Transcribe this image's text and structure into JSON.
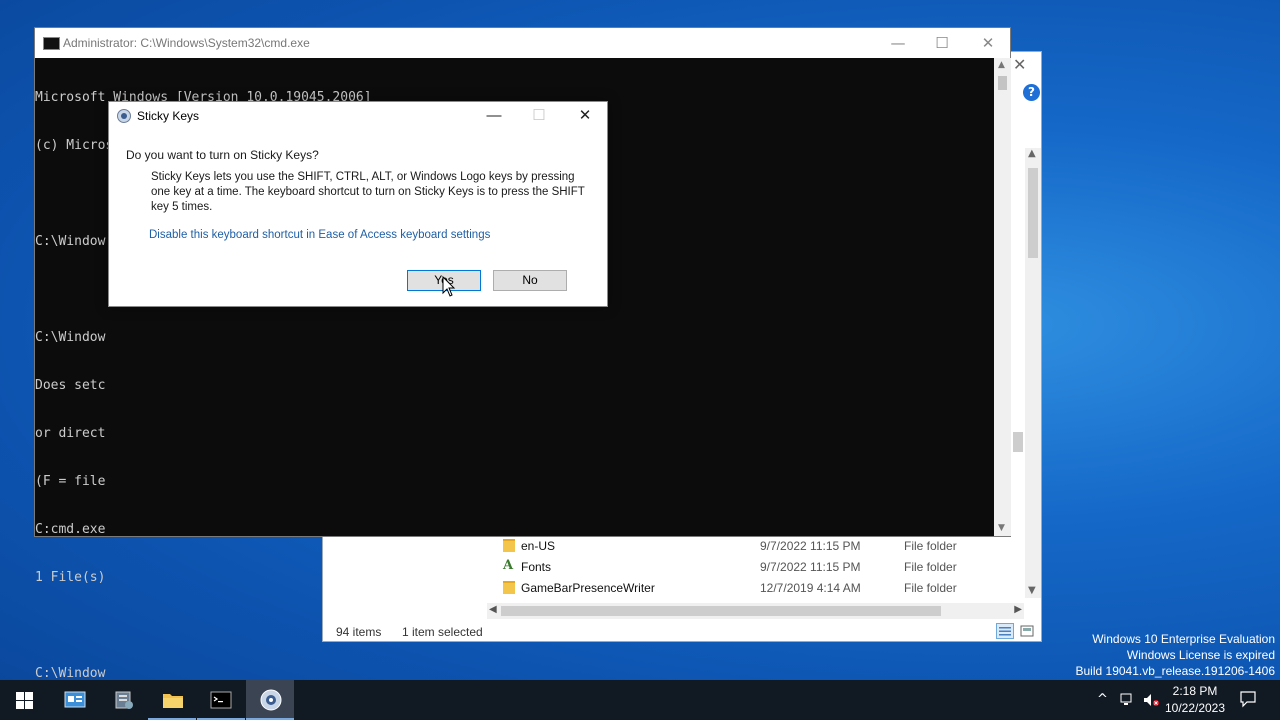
{
  "explorer": {
    "rows": [
      {
        "name": "en-US",
        "date": "9/7/2022 11:15 PM",
        "type": "File folder",
        "icon": "folder-icon"
      },
      {
        "name": "Fonts",
        "date": "9/7/2022 11:15 PM",
        "type": "File folder",
        "icon": "font-folder-icon"
      },
      {
        "name": "GameBarPresenceWriter",
        "date": "12/7/2019 4:14 AM",
        "type": "File folder",
        "icon": "folder-icon"
      }
    ],
    "status_items": "94 items",
    "status_selected": "1 item selected"
  },
  "cmd": {
    "title": "Administrator: C:\\Windows\\System32\\cmd.exe",
    "lines": [
      "Microsoft Windows [Version 10.0.19045.2006]",
      "(c) Microsoft Corporation. All rights reserved.",
      "",
      "C:\\Window",
      "",
      "C:\\Window",
      "Does setc",
      "or direct",
      "(F = file",
      "C:cmd.exe",
      "1 File(s)",
      "",
      "C:\\Window"
    ]
  },
  "dialog": {
    "title": "Sticky Keys",
    "question": "Do you want to turn on Sticky Keys?",
    "description": "Sticky Keys lets you use the SHIFT, CTRL, ALT, or Windows Logo keys by pressing one key at a time. The keyboard shortcut to turn on Sticky Keys is to press the SHIFT key 5 times.",
    "link": "Disable this keyboard shortcut in Ease of Access keyboard settings",
    "yes_label": "Yes",
    "no_label": "No"
  },
  "watermark": {
    "line1": "Windows 10 Enterprise Evaluation",
    "line2": "Windows License is expired",
    "line3": "Build 19041.vb_release.191206-1406"
  },
  "taskbar": {
    "time": "2:18 PM",
    "date": "10/22/2023"
  }
}
